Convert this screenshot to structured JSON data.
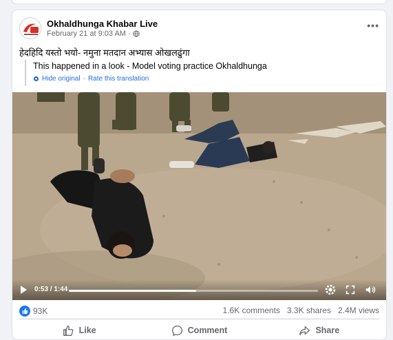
{
  "post": {
    "page_name": "Okhaldhunga Khabar Live",
    "date": "February 21 at 9:03 AM",
    "separator": "·",
    "caption": "हेदहिदि यस्तो भयो- नमुना मतदान अभ्यास ओखलढुंगा",
    "translation": {
      "text": "This happened in a look - Model voting practice Okhaldhunga",
      "hide_label": "Hide original",
      "dot": "·",
      "rate_label": "Rate this translation"
    }
  },
  "video": {
    "time": "0:53 / 1:44",
    "progress": 0.51
  },
  "stats": {
    "reactions": "93K",
    "comments": "1.6K comments",
    "shares": "3.3K shares",
    "views": "2.4M views"
  },
  "actions": {
    "like": "Like",
    "comment": "Comment",
    "share": "Share"
  },
  "icons": {
    "avatar": "news-logo-icon",
    "globe": "globe-icon",
    "more": "more-options-icon"
  },
  "colors": {
    "accent": "#1877f2",
    "link": "#216fdb"
  }
}
